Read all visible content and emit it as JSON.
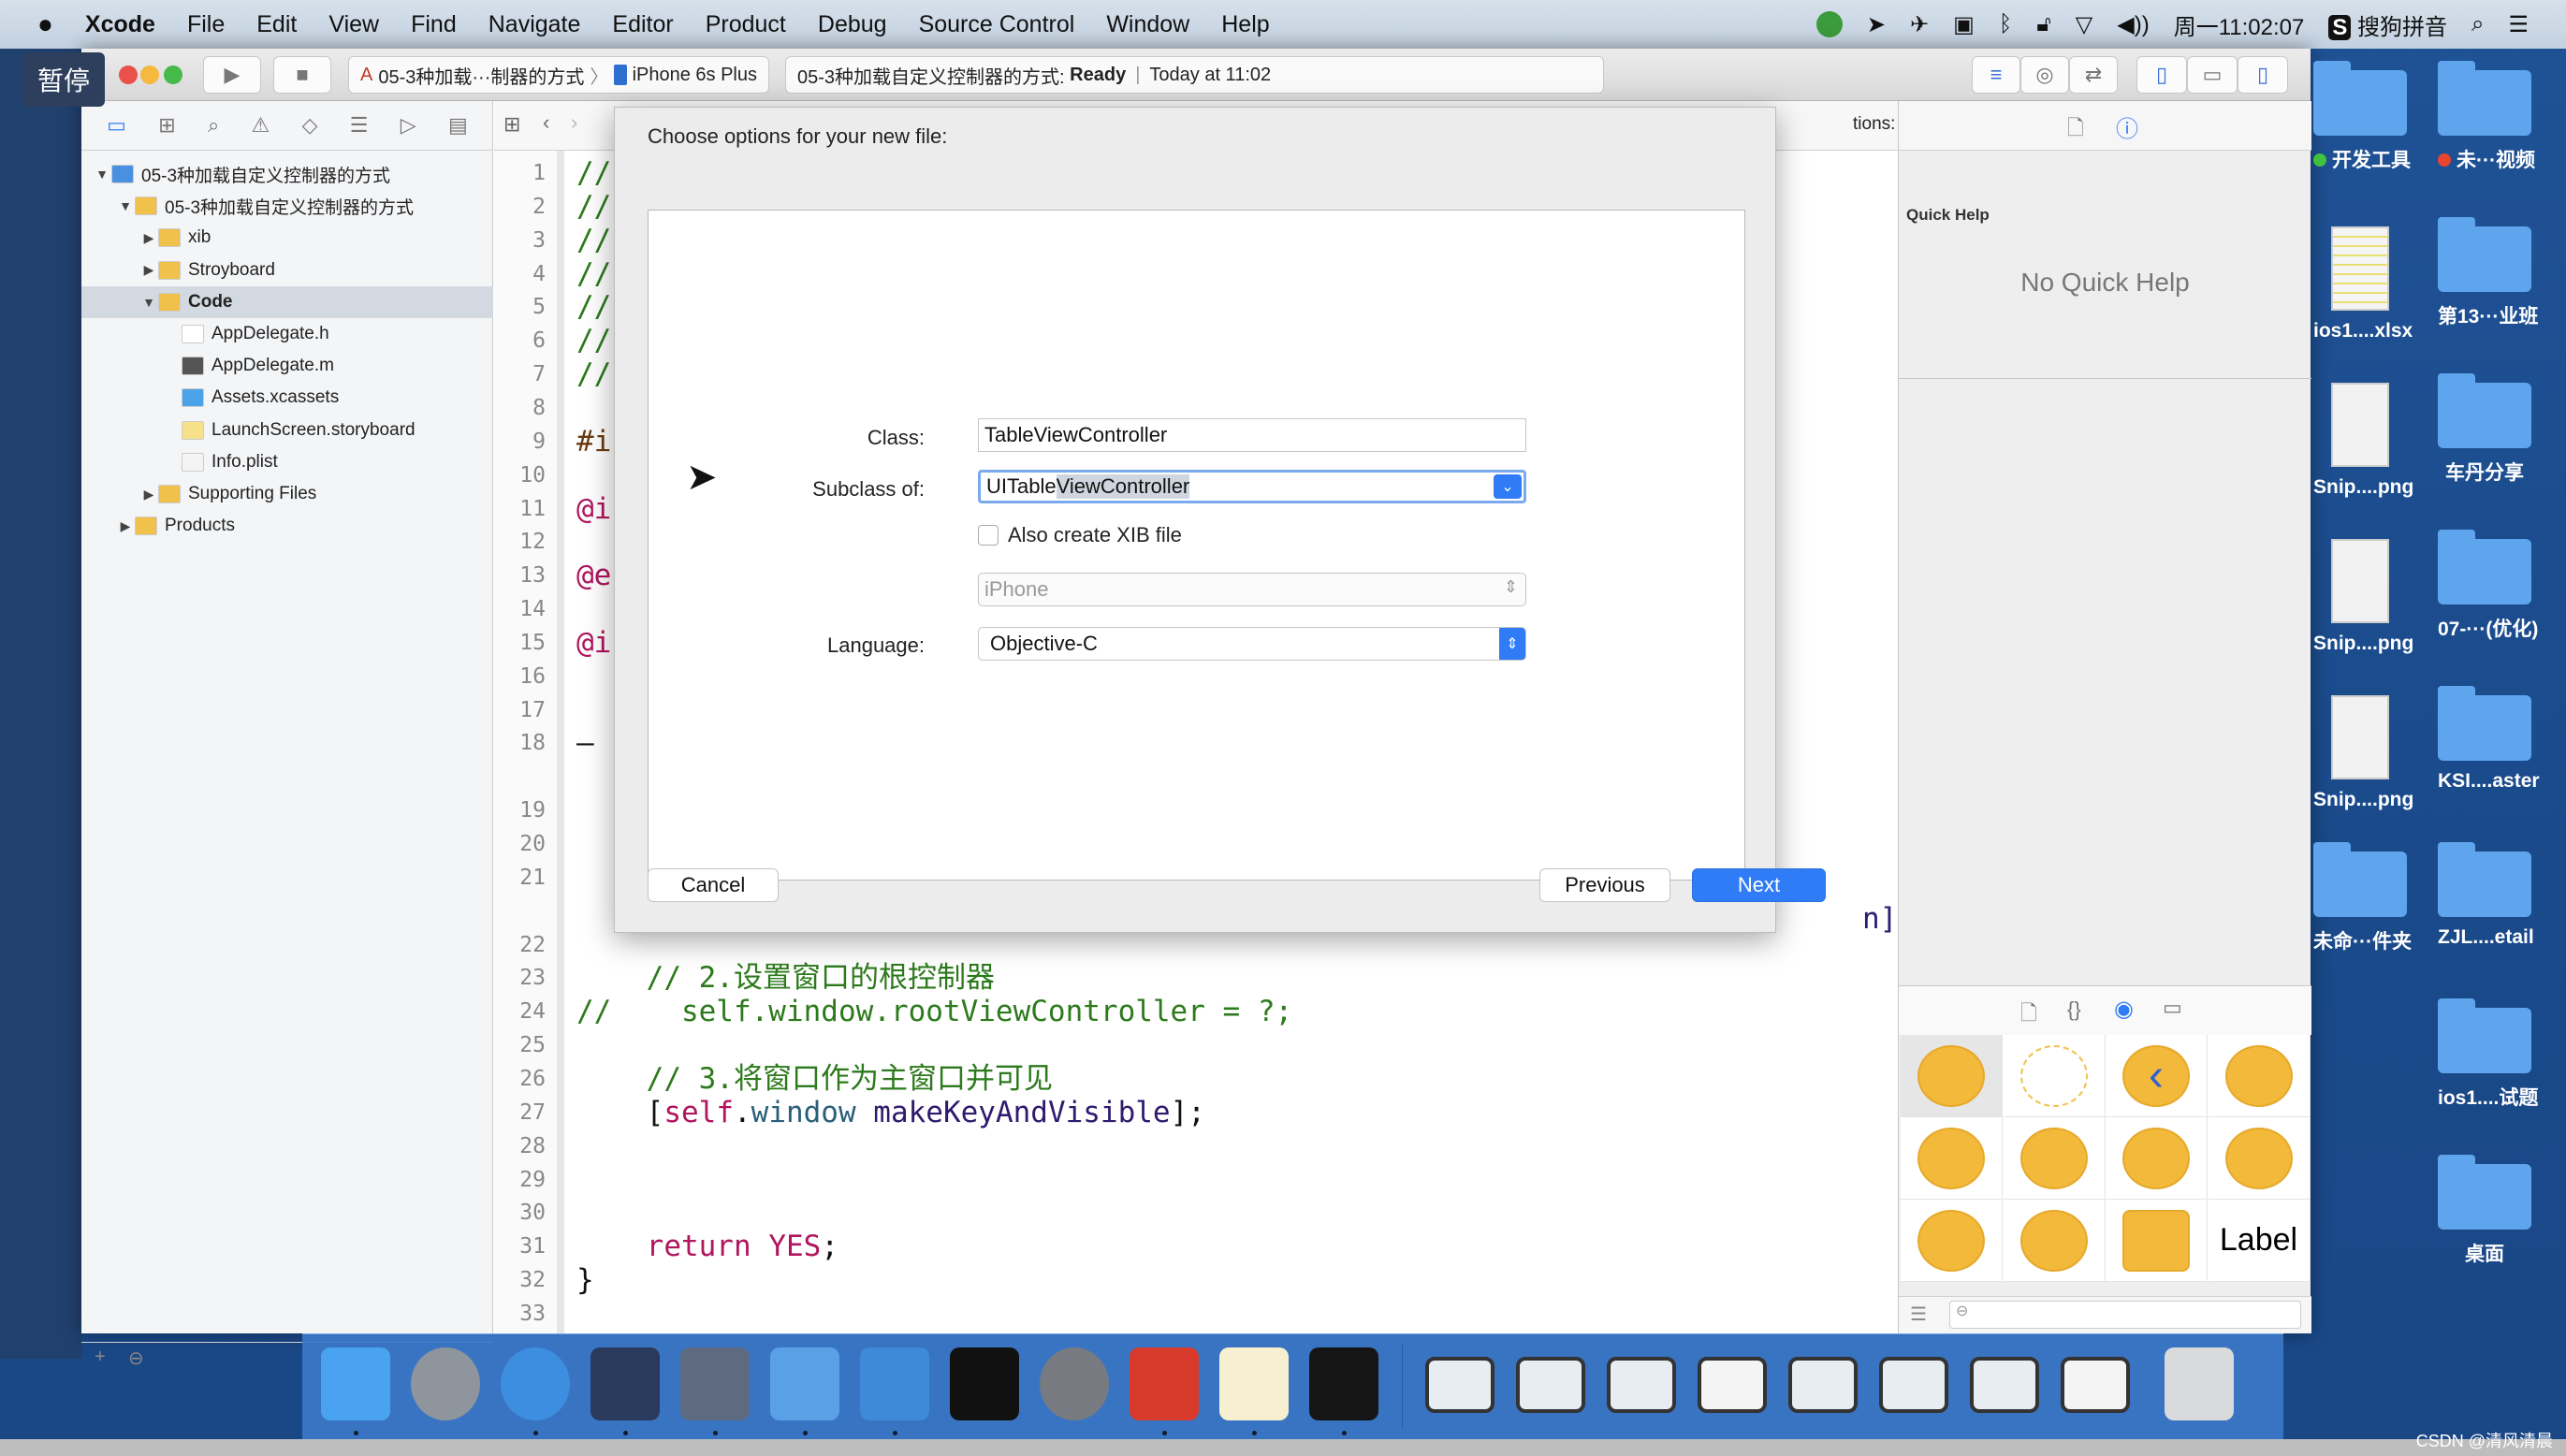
{
  "menubar": {
    "app": "Xcode",
    "items": [
      "File",
      "Edit",
      "View",
      "Find",
      "Navigate",
      "Editor",
      "Product",
      "Debug",
      "Source Control",
      "Window",
      "Help"
    ],
    "clock": "周一11:02:07",
    "input_method": "搜狗拼音",
    "input_method_badge": "S"
  },
  "overlay": {
    "pause_label": "暂停"
  },
  "toolbar": {
    "scheme": "05-3种加载···制器的方式",
    "device": "iPhone 6s Plus",
    "activity_project": "05-3种加载自定义控制器的方式:",
    "activity_status": "Ready",
    "activity_time": "Today at 11:02"
  },
  "navigator": {
    "tree": [
      {
        "label": "05-3种加载自定义控制器的方式",
        "level": 0,
        "expanded": true,
        "icon": "project"
      },
      {
        "label": "05-3种加载自定义控制器的方式",
        "level": 1,
        "expanded": true,
        "icon": "folder"
      },
      {
        "label": "xib",
        "level": 2,
        "expanded": false,
        "icon": "folder"
      },
      {
        "label": "Stroyboard",
        "level": 2,
        "expanded": false,
        "icon": "folder"
      },
      {
        "label": "Code",
        "level": 2,
        "expanded": true,
        "icon": "folder",
        "selected": true
      },
      {
        "label": "AppDelegate.h",
        "level": 3,
        "icon": "h-file"
      },
      {
        "label": "AppDelegate.m",
        "level": 3,
        "icon": "m-file"
      },
      {
        "label": "Assets.xcassets",
        "level": 3,
        "icon": "assets"
      },
      {
        "label": "LaunchScreen.storyboard",
        "level": 3,
        "icon": "storyboard"
      },
      {
        "label": "Info.plist",
        "level": 3,
        "icon": "plist"
      },
      {
        "label": "Supporting Files",
        "level": 2,
        "expanded": false,
        "icon": "folder"
      },
      {
        "label": "Products",
        "level": 1,
        "expanded": false,
        "icon": "folder"
      }
    ]
  },
  "editor": {
    "header_fragment": "tions:",
    "line21_tail": "n].",
    "lines": [
      {
        "n": "1",
        "seg": [
          {
            "t": "//",
            "type": "comment"
          }
        ]
      },
      {
        "n": "2",
        "seg": [
          {
            "t": "//",
            "type": "comment"
          }
        ]
      },
      {
        "n": "3",
        "seg": [
          {
            "t": "//",
            "type": "comment"
          }
        ]
      },
      {
        "n": "4",
        "seg": [
          {
            "t": "//",
            "type": "comment"
          }
        ]
      },
      {
        "n": "5",
        "seg": [
          {
            "t": "//",
            "type": "comment"
          }
        ]
      },
      {
        "n": "6",
        "seg": [
          {
            "t": "//",
            "type": "comment"
          }
        ]
      },
      {
        "n": "7",
        "seg": [
          {
            "t": "//",
            "type": "comment"
          }
        ]
      },
      {
        "n": "8",
        "seg": []
      },
      {
        "n": "9",
        "seg": [
          {
            "t": "#i",
            "type": "pre"
          }
        ]
      },
      {
        "n": "10",
        "seg": []
      },
      {
        "n": "11",
        "seg": [
          {
            "t": "@i",
            "type": "keyword"
          }
        ]
      },
      {
        "n": "12",
        "seg": []
      },
      {
        "n": "13",
        "seg": [
          {
            "t": "@e",
            "type": "keyword"
          }
        ]
      },
      {
        "n": "14",
        "seg": []
      },
      {
        "n": "15",
        "seg": [
          {
            "t": "@i",
            "type": "keyword"
          }
        ]
      },
      {
        "n": "16",
        "seg": []
      },
      {
        "n": "17",
        "seg": []
      },
      {
        "n": "18",
        "seg": [
          {
            "t": "–",
            "type": "plain"
          }
        ]
      },
      {
        "n": "19",
        "seg": []
      },
      {
        "n": "20",
        "seg": []
      },
      {
        "n": "21",
        "seg": []
      },
      {
        "n": "22",
        "seg": []
      },
      {
        "n": "23",
        "seg": [
          {
            "t": "    // 2.设置窗口的根控制器",
            "type": "comment"
          }
        ]
      },
      {
        "n": "24",
        "seg": [
          {
            "t": "//    self.window.rootViewController = ?;",
            "type": "comment"
          }
        ]
      },
      {
        "n": "25",
        "seg": []
      },
      {
        "n": "26",
        "seg": [
          {
            "t": "    // 3.将窗口作为主窗口并可见",
            "type": "comment"
          }
        ]
      },
      {
        "n": "27",
        "seg": [
          {
            "t": "    [",
            "type": "plain"
          },
          {
            "t": "self",
            "type": "keyword"
          },
          {
            "t": ".",
            "type": "plain"
          },
          {
            "t": "window",
            "type": "prop"
          },
          {
            "t": " makeKeyAndVisible",
            "type": "method"
          },
          {
            "t": "];",
            "type": "plain"
          }
        ]
      },
      {
        "n": "28",
        "seg": []
      },
      {
        "n": "29",
        "seg": []
      },
      {
        "n": "30",
        "seg": []
      },
      {
        "n": "31",
        "seg": [
          {
            "t": "    ",
            "type": "plain"
          },
          {
            "t": "return",
            "type": "keyword"
          },
          {
            "t": " ",
            "type": "plain"
          },
          {
            "t": "YES",
            "type": "keyword"
          },
          {
            "t": ";",
            "type": "plain"
          }
        ]
      },
      {
        "n": "32",
        "seg": [
          {
            "t": "}",
            "type": "plain"
          }
        ]
      },
      {
        "n": "33",
        "seg": []
      }
    ]
  },
  "dialog": {
    "title": "Choose options for your new file:",
    "class_label": "Class:",
    "class_value": "TableViewController",
    "subclass_label": "Subclass of:",
    "subclass_value_prefix": "UITable",
    "subclass_value_selected": "ViewController",
    "xib_label": "Also create XIB file",
    "xib_checked": false,
    "device_value": "iPhone",
    "language_label": "Language:",
    "language_value": "Objective-C",
    "cancel": "Cancel",
    "previous": "Previous",
    "next": "Next"
  },
  "inspector": {
    "quick_help_title": "Quick Help",
    "no_help": "No Quick Help",
    "library": [
      {
        "name": "view-controller"
      },
      {
        "name": "storyboard-reference"
      },
      {
        "name": "navigation-controller"
      },
      {
        "name": "table-view-controller"
      },
      {
        "name": "collection-view-controller"
      },
      {
        "name": "tab-bar-controller"
      },
      {
        "name": "split-view-controller"
      },
      {
        "name": "page-view-controller"
      },
      {
        "name": "glkit-view-controller"
      },
      {
        "name": "av-player-view-controller"
      },
      {
        "name": "object"
      },
      {
        "name": "label",
        "text": "Label"
      }
    ]
  },
  "desktop": {
    "col1": [
      {
        "label": "开发工具",
        "type": "folder",
        "tag": "#3fc23f"
      },
      {
        "label": "ios1....xlsx",
        "type": "xlsx"
      },
      {
        "label": "Snip....png",
        "type": "image"
      },
      {
        "label": "Snip....png",
        "type": "image"
      },
      {
        "label": "Snip....png",
        "type": "image"
      },
      {
        "label": "未命···件夹",
        "type": "folder"
      }
    ],
    "col2": [
      {
        "label": "未···视频",
        "type": "folder",
        "tag": "#e8442e"
      },
      {
        "label": "第13···业班",
        "type": "folder"
      },
      {
        "label": "车丹分享",
        "type": "folder"
      },
      {
        "label": "07-···(优化)",
        "type": "folder"
      },
      {
        "label": "KSI....aster",
        "type": "folder"
      },
      {
        "label": "ZJL....etail",
        "type": "folder"
      },
      {
        "label": "ios1....试题",
        "type": "folder"
      },
      {
        "label": "桌面",
        "type": "folder"
      }
    ]
  },
  "dock": {
    "apps": [
      {
        "name": "finder",
        "color": "#4aa3f0",
        "running": true
      },
      {
        "name": "launchpad",
        "color": "#8f959c",
        "running": false
      },
      {
        "name": "safari",
        "color": "#3d8de0",
        "running": true
      },
      {
        "name": "mouse-app",
        "color": "#2a3a5c",
        "running": true
      },
      {
        "name": "imovie",
        "color": "#5d6a80",
        "running": true
      },
      {
        "name": "xcode",
        "color": "#5aa0e6",
        "running": true
      },
      {
        "name": "instruments",
        "color": "#3f8ad8",
        "running": true
      },
      {
        "name": "terminal",
        "color": "#111111",
        "running": false
      },
      {
        "name": "system-preferences",
        "color": "#777a80",
        "running": false
      },
      {
        "name": "xmind",
        "color": "#d83a2c",
        "running": true
      },
      {
        "name": "notes",
        "color": "#f6f0d0",
        "running": true
      },
      {
        "name": "console",
        "color": "#151515",
        "running": true
      },
      {
        "name": "minimized-window-1",
        "color": "#e8edf2"
      },
      {
        "name": "minimized-window-2",
        "color": "#e8edf2"
      },
      {
        "name": "minimized-window-3",
        "color": "#e8edf2"
      },
      {
        "name": "minimized-window-4",
        "color": "#f4f4f4"
      },
      {
        "name": "minimized-window-5",
        "color": "#e8edf2"
      },
      {
        "name": "minimized-window-6",
        "color": "#e8edf2"
      },
      {
        "name": "minimized-window-7",
        "color": "#e8edf2"
      },
      {
        "name": "minimized-window-8",
        "color": "#f4f4f4"
      },
      {
        "name": "trash",
        "color": "#d8dadc"
      }
    ]
  },
  "watermark": "CSDN @清风清晨",
  "colors": {
    "accent": "#2f7cf6",
    "comment": "#2c7a1c",
    "keyword": "#b0155e",
    "desktop": "#1c4e8f",
    "library_icon": "#f3b93a"
  }
}
